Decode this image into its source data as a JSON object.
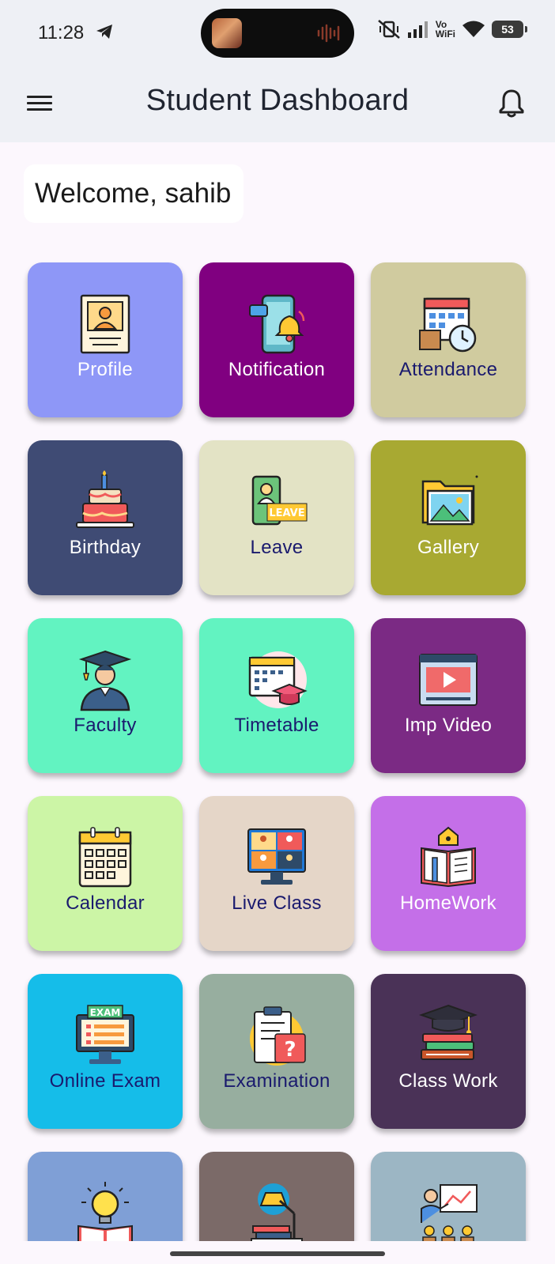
{
  "status": {
    "time": "11:28",
    "vowifi_top": "Vo",
    "vowifi_bottom": "WiFi",
    "battery": "53"
  },
  "header": {
    "title": "Student Dashboard",
    "menu_icon": "hamburger-menu-icon",
    "notification_icon": "bell-icon"
  },
  "welcome": "Welcome, sahib",
  "tiles": [
    {
      "label": "Profile",
      "bg": "#8e97f7",
      "fg": "#ffffff",
      "icon": "profile-card-icon"
    },
    {
      "label": "Notification",
      "bg": "#800080",
      "fg": "#ffffff",
      "icon": "phone-bell-icon"
    },
    {
      "label": "Attendance",
      "bg": "#d0cb9f",
      "fg": "#1a1a6e",
      "icon": "calendar-clock-icon"
    },
    {
      "label": "Birthday",
      "bg": "#3f4b74",
      "fg": "#ffffff",
      "icon": "birthday-cake-icon"
    },
    {
      "label": "Leave",
      "bg": "#e3e3c5",
      "fg": "#1a1a6e",
      "icon": "leave-card-icon"
    },
    {
      "label": "Gallery",
      "bg": "#a8a932",
      "fg": "#ffffff",
      "icon": "photo-folder-icon"
    },
    {
      "label": "Faculty",
      "bg": "#62f3c1",
      "fg": "#1a1a6e",
      "icon": "graduate-icon"
    },
    {
      "label": "Timetable",
      "bg": "#62f3c1",
      "fg": "#1a1a6e",
      "icon": "calendar-cap-icon"
    },
    {
      "label": "Imp Video",
      "bg": "#7b2a84",
      "fg": "#ffffff",
      "icon": "video-player-icon"
    },
    {
      "label": "Calendar",
      "bg": "#ccf5a6",
      "fg": "#1a1a6e",
      "icon": "calendar-icon"
    },
    {
      "label": "Live Class",
      "bg": "#e5d6c8",
      "fg": "#1a1a6e",
      "icon": "video-conference-icon"
    },
    {
      "label": "HomeWork",
      "bg": "#c46fe8",
      "fg": "#ffffff",
      "icon": "book-home-icon"
    },
    {
      "label": "Online Exam",
      "bg": "#15bde9",
      "fg": "#1a1a6e",
      "icon": "exam-monitor-icon"
    },
    {
      "label": "Examination",
      "bg": "#97ae9f",
      "fg": "#1a1a6e",
      "icon": "clipboard-question-icon"
    },
    {
      "label": "Class Work",
      "bg": "#4a3257",
      "fg": "#ffffff",
      "icon": "books-cap-icon"
    },
    {
      "label": "",
      "bg": "#7f9fd6",
      "fg": "#1a1a6e",
      "icon": "lightbulb-book-icon"
    },
    {
      "label": "",
      "bg": "#7b6a68",
      "fg": "#ffffff",
      "icon": "desk-lamp-books-icon"
    },
    {
      "label": "",
      "bg": "#9cb6c4",
      "fg": "#1a1a6e",
      "icon": "teacher-board-icon"
    }
  ]
}
